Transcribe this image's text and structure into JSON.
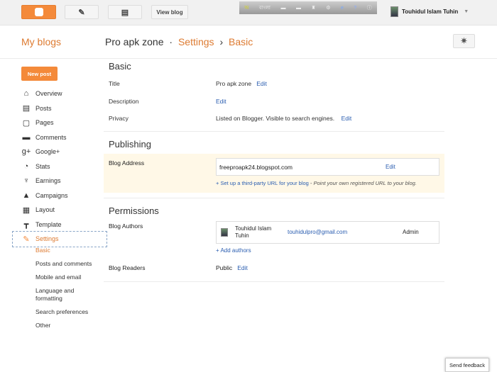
{
  "topbar": {
    "view_blog": "View blog",
    "ime_label": "বাংলা",
    "user_name": "Touhidul Islam Tuhin"
  },
  "header": {
    "my_blogs": "My blogs",
    "blog_name": "Pro apk zone",
    "sep1": "·",
    "settings": "Settings",
    "sep2": "›",
    "basic": "Basic"
  },
  "sidebar": {
    "new_post": "New post",
    "items": [
      {
        "label": "Overview",
        "icon": "⌂"
      },
      {
        "label": "Posts",
        "icon": "▤"
      },
      {
        "label": "Pages",
        "icon": "▢"
      },
      {
        "label": "Comments",
        "icon": "▬"
      },
      {
        "label": "Google+",
        "icon": "g+"
      },
      {
        "label": "Stats",
        "icon": "◔"
      },
      {
        "label": "Earnings",
        "icon": "♆"
      },
      {
        "label": "Campaigns",
        "icon": "▲"
      },
      {
        "label": "Layout",
        "icon": "▦"
      },
      {
        "label": "Template",
        "icon": "┳"
      },
      {
        "label": "Settings",
        "icon": "✎"
      }
    ],
    "sub_items": [
      "Basic",
      "Posts and comments",
      "Mobile and email",
      "Language and formatting",
      "Search preferences",
      "Other"
    ]
  },
  "basic": {
    "heading": "Basic",
    "title_label": "Title",
    "title_value": "Pro apk zone",
    "description_label": "Description",
    "privacy_label": "Privacy",
    "privacy_value": "Listed on Blogger. Visible to search engines.",
    "edit": "Edit"
  },
  "publishing": {
    "heading": "Publishing",
    "address_label": "Blog Address",
    "address": "freeproapk24.blogspot.com",
    "third_party_link": "+ Set up a third-party URL for your blog",
    "third_party_note": " - Point your own registered URL to your blog."
  },
  "permissions": {
    "heading": "Permissions",
    "authors_label": "Blog Authors",
    "author_name": "Touhidul Islam Tuhin",
    "author_email": "touhidulpro@gmail.com",
    "author_role": "Admin",
    "add_authors": "+ Add authors",
    "readers_label": "Blog Readers",
    "readers_value": "Public"
  },
  "footer": {
    "send_feedback": "Send feedback"
  }
}
